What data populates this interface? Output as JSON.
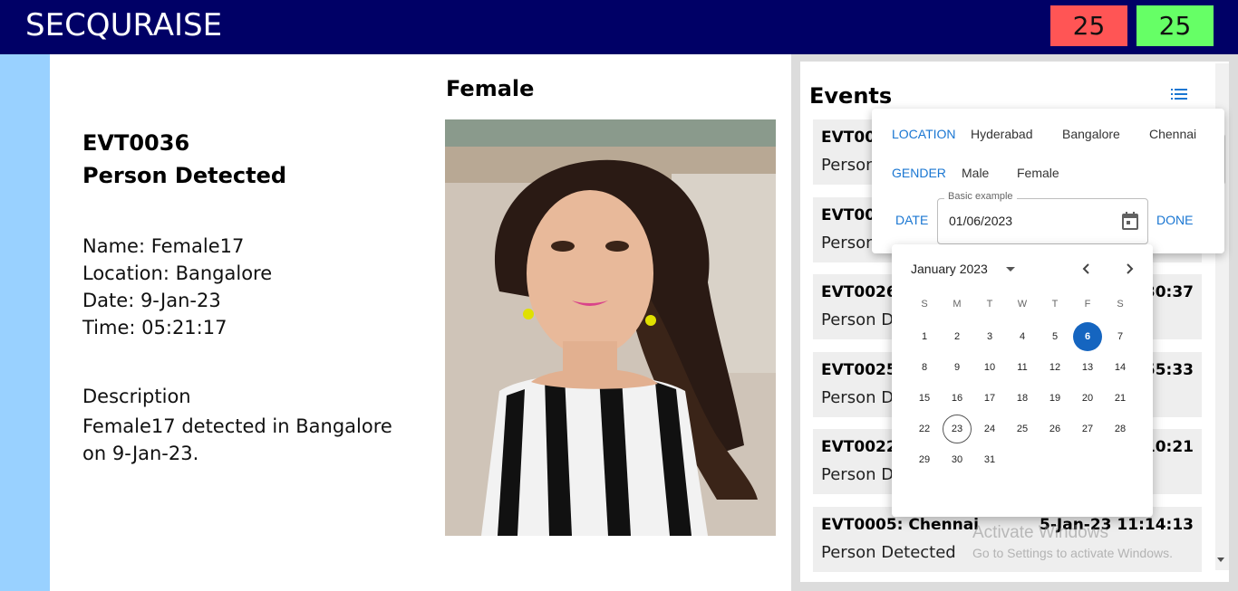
{
  "header": {
    "brand": "SECQURAISE",
    "count_red": "25",
    "count_green": "25",
    "colors": {
      "bar": "#000066",
      "red": "#ff5555",
      "green": "#66ff66",
      "strip": "#99d1ff"
    }
  },
  "detail": {
    "event_id": "EVT0036",
    "event_type": "Person Detected",
    "name_line": "Name: Female17",
    "location_line": "Location: Bangalore",
    "date_line": "Date: 9-Jan-23",
    "time_line": "Time: 05:21:17",
    "description_title": "Description",
    "description_text": "Female17 detected in Bangalore on 9-Jan-23.",
    "gender": "Female",
    "photo_icon": "person-photo"
  },
  "events": {
    "title": "Events",
    "filter_icon": "list-icon",
    "items": [
      {
        "head": "EVT00",
        "time": "",
        "sub": "Person"
      },
      {
        "head": "EVT00",
        "time": "",
        "sub": "Person"
      },
      {
        "head": "EVT0026",
        "time": "30:37",
        "sub": "Person D"
      },
      {
        "head": "EVT0025",
        "time": "55:33",
        "sub": "Person D"
      },
      {
        "head": "EVT0022",
        "time": ":10:21",
        "sub": "Person D"
      },
      {
        "head": "EVT0005: Chennai",
        "time": "5-Jan-23 11:14:13",
        "sub": "Person Detected"
      }
    ]
  },
  "filter": {
    "location_label": "LOCATION",
    "locations": [
      "Hyderabad",
      "Bangalore",
      "Chennai"
    ],
    "gender_label": "GENDER",
    "genders": [
      "Male",
      "Female"
    ],
    "date_label": "DATE",
    "date_field_label": "Basic example",
    "date_value": "01/06/2023",
    "done_label": "DONE",
    "accent": "#1976d2"
  },
  "calendar": {
    "month_label": "January 2023",
    "weekdays": [
      "S",
      "M",
      "T",
      "W",
      "T",
      "F",
      "S"
    ],
    "days": [
      "1",
      "2",
      "3",
      "4",
      "5",
      "6",
      "7",
      "8",
      "9",
      "10",
      "11",
      "12",
      "13",
      "14",
      "15",
      "16",
      "17",
      "18",
      "19",
      "20",
      "21",
      "22",
      "23",
      "24",
      "25",
      "26",
      "27",
      "28",
      "29",
      "30",
      "31"
    ],
    "selected_day": "6",
    "today_day": "23",
    "selected_color": "#1565c0"
  },
  "watermark": {
    "line1": "Activate Windows",
    "line2": "Go to Settings to activate Windows."
  }
}
